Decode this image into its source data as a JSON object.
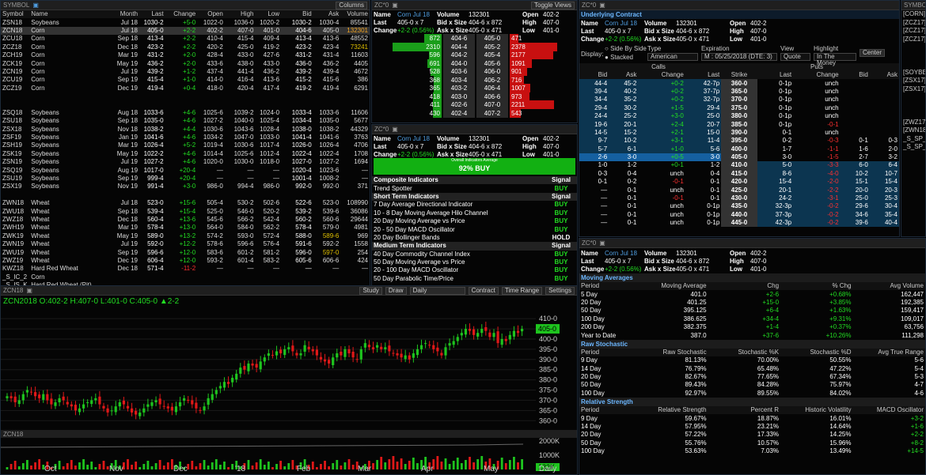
{
  "quotes": {
    "title": "SYMBOL",
    "columns_btn": "Columns",
    "headers": [
      "Symbol",
      "Name",
      "Month",
      "Last",
      "Change",
      "Open",
      "High",
      "Low",
      "Bid",
      "Ask",
      "Volume"
    ],
    "rows": [
      [
        "ZSN18",
        "Soybeans",
        "Jul 18",
        "1030-2",
        "+5-0",
        "1022-0",
        "1036-0",
        "1020-2",
        "1030-2",
        "1030-4",
        "85541"
      ],
      [
        "ZCN18",
        "Corn",
        "Jul 18",
        "405-0",
        "+2-2",
        "402-2",
        "407-0",
        "401-0",
        "404-6",
        "405-0",
        "132301"
      ],
      [
        "ZCU18",
        "Corn",
        "Sep 18",
        "413-4",
        "+2-2",
        "410-4",
        "415-4",
        "409-4",
        "413-4",
        "413-6",
        "48552"
      ],
      [
        "ZCZ18",
        "Corn",
        "Dec 18",
        "423-2",
        "+2-2",
        "420-2",
        "425-0",
        "419-2",
        "423-2",
        "423-4",
        "73241"
      ],
      [
        "ZCH19",
        "Corn",
        "Mar 19",
        "431-2",
        "+2-0",
        "428-4",
        "433-0",
        "427-6",
        "431-2",
        "431-4",
        "11603"
      ],
      [
        "ZCK19",
        "Corn",
        "May 19",
        "436-2",
        "+2-0",
        "433-6",
        "438-0",
        "433-0",
        "436-0",
        "436-2",
        "4405"
      ],
      [
        "ZCN19",
        "Corn",
        "Jul 19",
        "439-2",
        "+1-2",
        "437-4",
        "441-4",
        "436-2",
        "439-2",
        "439-4",
        "4672"
      ],
      [
        "ZCU19",
        "Corn",
        "Sep 19",
        "415-4",
        "+1-0",
        "414-0",
        "416-4",
        "413-6",
        "415-2",
        "415-6",
        "386"
      ],
      [
        "ZCZ19",
        "Corn",
        "Dec 19",
        "419-4",
        "+0-4",
        "418-0",
        "420-4",
        "417-4",
        "419-2",
        "419-4",
        "6291"
      ],
      [
        "",
        "",
        "",
        "",
        "",
        "",
        "",
        "",
        "",
        "",
        ""
      ],
      [
        "",
        "",
        "",
        "",
        "",
        "",
        "",
        "",
        "",
        "",
        ""
      ],
      [
        "ZSQ18",
        "Soybeans",
        "Aug 18",
        "1033-6",
        "+4-6",
        "1025-6",
        "1039-2",
        "1024-0",
        "1033-4",
        "1033-6",
        "11606"
      ],
      [
        "ZSU18",
        "Soybeans",
        "Sep 18",
        "1035-0",
        "+4-6",
        "1027-2",
        "1040-0",
        "1025-4",
        "1034-4",
        "1035-0",
        "5677"
      ],
      [
        "ZSX18",
        "Soybeans",
        "Nov 18",
        "1038-2",
        "+4-4",
        "1030-6",
        "1043-6",
        "1028-4",
        "1038-0",
        "1038-2",
        "44329"
      ],
      [
        "ZSF19",
        "Soybeans",
        "Jan 19",
        "1041-6",
        "+4-6",
        "1034-2",
        "1047-0",
        "1033-0",
        "1041-4",
        "1041-6",
        "3763"
      ],
      [
        "ZSH19",
        "Soybeans",
        "Mar 19",
        "1026-4",
        "+5-2",
        "1019-4",
        "1030-6",
        "1017-4",
        "1026-0",
        "1026-4",
        "4706"
      ],
      [
        "ZSK19",
        "Soybeans",
        "May 19",
        "1022-2",
        "+4-6",
        "1014-4",
        "1025-6",
        "1012-4",
        "1022-4",
        "1022-4",
        "1708"
      ],
      [
        "ZSN19",
        "Soybeans",
        "Jul 19",
        "1027-2",
        "+4-6",
        "1020-0",
        "1030-0",
        "1018-0",
        "1027-0",
        "1027-2",
        "1694"
      ],
      [
        "ZSQ19",
        "Soybeans",
        "Aug 19",
        "1017-0",
        "+20-4",
        "—",
        "—",
        "—",
        "1020-4",
        "1023-6",
        "—"
      ],
      [
        "ZSU19",
        "Soybeans",
        "Sep 19",
        "999-4",
        "+20-4",
        "—",
        "—",
        "—",
        "1001-4",
        "1008-2",
        "—"
      ],
      [
        "ZSX19",
        "Soybeans",
        "Nov 19",
        "991-4",
        "+3-0",
        "986-0",
        "994-4",
        "986-0",
        "992-0",
        "992-0",
        "371"
      ],
      [
        "",
        "",
        "",
        "",
        "",
        "",
        "",
        "",
        "",
        "",
        ""
      ],
      [
        "ZWN18",
        "Wheat",
        "Jul 18",
        "523-0",
        "+15-6",
        "505-4",
        "530-2",
        "502-6",
        "522-6",
        "523-0",
        "108990"
      ],
      [
        "ZWU18",
        "Wheat",
        "Sep 18",
        "539-4",
        "+15-4",
        "525-0",
        "546-0",
        "520-2",
        "539-2",
        "539-6",
        "36086"
      ],
      [
        "ZWZ18",
        "Wheat",
        "Dec 18",
        "560-4",
        "+13-6",
        "545-6",
        "566-2",
        "542-4",
        "560-2",
        "560-6",
        "29644"
      ],
      [
        "ZWH19",
        "Wheat",
        "Mar 19",
        "578-4",
        "+13-0",
        "564-0",
        "584-0",
        "562-2",
        "578-4",
        "579-0",
        "4981"
      ],
      [
        "ZWK19",
        "Wheat",
        "May 19",
        "589-0",
        "+13-2",
        "574-2",
        "593-0",
        "572-4",
        "588-0",
        "589-6",
        "969"
      ],
      [
        "ZWN19",
        "Wheat",
        "Jul 19",
        "592-0",
        "+12-2",
        "578-6",
        "596-6",
        "576-4",
        "591-6",
        "592-2",
        "1558"
      ],
      [
        "ZWU19",
        "Wheat",
        "Sep 19",
        "596-6",
        "+12-0",
        "583-6",
        "601-2",
        "581-2",
        "596-0",
        "597-0",
        "254"
      ],
      [
        "ZWZ19",
        "Wheat",
        "Dec 19",
        "606-4",
        "+12-0",
        "593-2",
        "601-4",
        "583-2",
        "605-6",
        "606-6",
        "424"
      ],
      [
        "KWZ18",
        "Hard Red Wheat",
        "Dec 18",
        "571-4",
        "-11-2",
        "—",
        "—",
        "—",
        "—",
        "—",
        "—"
      ],
      [
        "_S_IC_2",
        "Corn",
        "",
        "",
        "",
        "",
        "",
        "",
        "",
        "",
        ""
      ],
      [
        "_S_IS_K",
        "Hard Red Wheat (Pit)",
        "",
        "",
        "",
        "",
        "",
        "",
        "",
        "",
        ""
      ]
    ]
  },
  "book": {
    "title": "ZC*0",
    "toggle": "Toggle Views",
    "info": {
      "name": "Corn Jul 18",
      "volume": "132301",
      "open": "402-2",
      "last": "405-0 x 7",
      "bid": "404-6 x 872",
      "high": "407-0",
      "change": "+2-2 (0.56%)",
      "ask": "405-0 x 471",
      "low": "401-0"
    },
    "levels": [
      {
        "bsize": "872",
        "bid": "404-6",
        "ask": "405-0",
        "asize": "471",
        "bf": 0.25,
        "af": 0.13
      },
      {
        "bsize": "2310",
        "bid": "404-4",
        "ask": "405-2",
        "asize": "2378",
        "bf": 0.7,
        "af": 0.7
      },
      {
        "bsize": "596",
        "bid": "404-2",
        "ask": "405-4",
        "asize": "2177",
        "bf": 0.18,
        "af": 0.64
      },
      {
        "bsize": "691",
        "bid": "404-0",
        "ask": "405-6",
        "asize": "1091",
        "bf": 0.2,
        "af": 0.32
      },
      {
        "bsize": "528",
        "bid": "403-6",
        "ask": "406-0",
        "asize": "901",
        "bf": 0.16,
        "af": 0.26
      },
      {
        "bsize": "368",
        "bid": "403-4",
        "ask": "406-2",
        "asize": "716",
        "bf": 0.11,
        "af": 0.21
      },
      {
        "bsize": "365",
        "bid": "403-2",
        "ask": "406-4",
        "asize": "1007",
        "bf": 0.11,
        "af": 0.3
      },
      {
        "bsize": "418",
        "bid": "403-0",
        "ask": "406-6",
        "asize": "973",
        "bf": 0.12,
        "af": 0.29
      },
      {
        "bsize": "411",
        "bid": "402-6",
        "ask": "407-0",
        "asize": "2211",
        "bf": 0.12,
        "af": 0.65
      },
      {
        "bsize": "430",
        "bid": "402-4",
        "ask": "407-2",
        "asize": "543",
        "bf": 0.13,
        "af": 0.16
      }
    ]
  },
  "tech": {
    "title": "ZC*0",
    "gauge_small": "Overall Indicators Average",
    "gauge": "92% BUY",
    "sections": [
      {
        "name": "Composite Indicators",
        "sig": "Signal",
        "rows": [
          [
            "Trend Spotter",
            "BUY"
          ]
        ]
      },
      {
        "name": "Short Term Indicators",
        "sig": "Signal",
        "rows": [
          [
            "7 Day Average Directional Indicator",
            "BUY"
          ],
          [
            "10 - 8 Day Moving Average Hilo Channel",
            "BUY"
          ],
          [
            "20 Day Moving Average vs Price",
            "BUY"
          ],
          [
            "20 - 50 Day MACD Oscillator",
            "BUY"
          ],
          [
            "20 Day Bollinger Bands",
            "HOLD"
          ]
        ]
      },
      {
        "name": "Medium Term Indicators",
        "sig": "Signal",
        "rows": [
          [
            "40 Day Commodity Channel Index",
            "BUY"
          ],
          [
            "50 Day Moving Average vs Price",
            "BUY"
          ],
          [
            "20 - 100 Day MACD Oscillator",
            "BUY"
          ],
          [
            "50 Day Parabolic Time/Price",
            "BUY"
          ]
        ]
      }
    ]
  },
  "options": {
    "title": "ZC*0",
    "section": "Underlying Contract",
    "display": "Display:",
    "sbs": "Side By Side",
    "stacked": "Stacked",
    "type_lbl": "Type",
    "type": "American",
    "exp_lbl": "Expiration",
    "exp": "M : 05/25/2018 (DTE: 3)",
    "view_lbl": "View",
    "view": "Quote",
    "hl_lbl": "Highlight",
    "hl": "In The Money",
    "center": "Center",
    "calls": "Calls",
    "puts": "Puts",
    "headers": [
      "Bid",
      "Ask",
      "Change",
      "Last",
      "Strike",
      "Last",
      "Change",
      "Bid",
      "Ask"
    ],
    "rows": [
      [
        "44-4",
        "45-2",
        "+0-2",
        "42-7p",
        "360-0",
        "0-1p",
        "unch",
        "",
        ""
      ],
      [
        "39-4",
        "40-2",
        "+0-2",
        "37-7p",
        "365-0",
        "0-1p",
        "unch",
        "",
        ""
      ],
      [
        "34-4",
        "35-2",
        "+0-2",
        "32-7p",
        "370-0",
        "0-1p",
        "unch",
        "",
        ""
      ],
      [
        "29-4",
        "30-2",
        "+1-5",
        "29-4",
        "375-0",
        "0-1p",
        "unch",
        "",
        ""
      ],
      [
        "24-4",
        "25-2",
        "+3-0",
        "25-0",
        "380-0",
        "0-1p",
        "unch",
        "",
        ""
      ],
      [
        "19-6",
        "20-1",
        "+2-4",
        "20-7",
        "385-0",
        "0-1p",
        "-0-1",
        "",
        ""
      ],
      [
        "14-5",
        "15-2",
        "+2-1",
        "15-0",
        "390-0",
        "0-1",
        "unch",
        "",
        ""
      ],
      [
        "9-7",
        "10-2",
        "+3-1",
        "11-4",
        "395-0",
        "0-2",
        "-0-3",
        "0-1",
        "0-3"
      ],
      [
        "5-7",
        "6-1",
        "+1-0",
        "5-6",
        "400-0",
        "1-7",
        "-1-1",
        "1-6",
        "2-0"
      ],
      [
        "2-6",
        "3-0",
        "+0-5",
        "3-0",
        "405-0",
        "3-0",
        "-1-5",
        "2-7",
        "3-2"
      ],
      [
        "1-0",
        "1-2",
        "+0-1",
        "1-2",
        "410-0",
        "5-0",
        "-3-3",
        "6-0",
        "6-4"
      ],
      [
        "0-3",
        "0-4",
        "unch",
        "0-4",
        "415-0",
        "8-6",
        "-4-0",
        "10-2",
        "10-7"
      ],
      [
        "0-1",
        "0-2",
        "-0-1",
        "0-1",
        "420-0",
        "15-4",
        "-2-0",
        "15-1",
        "15-4"
      ],
      [
        "—",
        "0-1",
        "unch",
        "0-1",
        "425-0",
        "20-1",
        "-2-2",
        "20-0",
        "20-3"
      ],
      [
        "—",
        "0-1",
        "-0-1",
        "0-1",
        "430-0",
        "24-2",
        "-3-1",
        "25-0",
        "25-3"
      ],
      [
        "—",
        "0-1",
        "unch",
        "0-1p",
        "435-0",
        "32-3p",
        "-0-2",
        "29-6",
        "30-4"
      ],
      [
        "—",
        "0-1",
        "unch",
        "0-1p",
        "440-0",
        "37-3p",
        "-0-2",
        "34-6",
        "35-4"
      ],
      [
        "—",
        "0-1",
        "unch",
        "0-1p",
        "445-0",
        "42-3p",
        "-0-2",
        "39-6",
        "40-4"
      ]
    ]
  },
  "syms": {
    "title": "SYMBOL",
    "items": [
      "[CORN]",
      "[ZCZ17]",
      "[ZCZ17]",
      "[ZCZ17]",
      "",
      "",
      "",
      "[SOYBEA",
      "[ZSX17]",
      "[ZSX17]",
      "",
      "",
      "",
      "[ZWZ17]",
      "[ZWN18]",
      "_S_SP_Z",
      "_S_SP_Z"
    ]
  },
  "stats": {
    "title": "ZC*0",
    "moving": {
      "name": "Moving Averages",
      "headers": [
        "Period",
        "Moving Average",
        "Chg",
        "% Chg",
        "Avg Volume"
      ],
      "rows": [
        [
          "5 Day",
          "401.0",
          "+2-6",
          "+0.68%",
          "162,447"
        ],
        [
          "20 Day",
          "401.25",
          "+15-0",
          "+3.85%",
          "192,385"
        ],
        [
          "50 Day",
          "395.125",
          "+6-4",
          "+1.63%",
          "159,417"
        ],
        [
          "100 Day",
          "386.625",
          "+34-4",
          "+9.31%",
          "109,017"
        ],
        [
          "200 Day",
          "382.375",
          "+1-4",
          "+0.37%",
          "63,756"
        ],
        [
          "Year to Date",
          "387.0",
          "+37-6",
          "+10.26%",
          "111,298"
        ]
      ]
    },
    "raw": {
      "name": "Raw Stochastic",
      "headers": [
        "Period",
        "Raw Stochastic",
        "Stochastic %K",
        "Stochastic %D",
        "Avg True Range"
      ],
      "rows": [
        [
          "9 Day",
          "81.13%",
          "70.00%",
          "50.55%",
          "5-6"
        ],
        [
          "14 Day",
          "76.79%",
          "65.48%",
          "47.22%",
          "5-4"
        ],
        [
          "20 Day",
          "82.67%",
          "77.65%",
          "67.34%",
          "5-3"
        ],
        [
          "50 Day",
          "89.43%",
          "84.28%",
          "75.97%",
          "4-7"
        ],
        [
          "100 Day",
          "92.97%",
          "89.55%",
          "84.02%",
          "4-6"
        ]
      ]
    },
    "rel": {
      "name": "Relative Strength",
      "headers": [
        "Period",
        "Relative Strength",
        "Percent R",
        "Historic Volatility",
        "MACD Oscillator"
      ],
      "rows": [
        [
          "9 Day",
          "59.67%",
          "18.87%",
          "16.01%",
          "+3-2"
        ],
        [
          "14 Day",
          "57.95%",
          "23.21%",
          "14.64%",
          "+1-6"
        ],
        [
          "20 Day",
          "57.22%",
          "17.33%",
          "14.25%",
          "+2-2"
        ],
        [
          "50 Day",
          "55.76%",
          "10.57%",
          "15.96%",
          "+8-2"
        ],
        [
          "100 Day",
          "53.63%",
          "7.03%",
          "13.49%",
          "+14-5"
        ]
      ]
    }
  },
  "chart": {
    "title": "ZCN18",
    "study": "Study",
    "draw": "Draw",
    "period": "Daily",
    "contract": "Contract",
    "timerange": "Time Range",
    "settings": "Settings",
    "ohlc": "ZCN2018  O:402-2 H:407-0 L:401-0 C:405-0 ▲2-2",
    "price_ticks": [
      "410-0",
      "405-0",
      "400-0",
      "395-0",
      "390-0",
      "385-0",
      "380-0",
      "375-0",
      "370-0",
      "365-0",
      "360-0"
    ],
    "last_price": "405-0",
    "vol_ticks": [
      "2000K",
      "1000K"
    ],
    "vol_last": "132K",
    "months": [
      "Oct",
      "Nov",
      "Dec",
      "'18",
      "Feb",
      "Mar",
      "Apr",
      "May"
    ],
    "period_lbl": "Daily",
    "sub_title": "ZCN18"
  }
}
